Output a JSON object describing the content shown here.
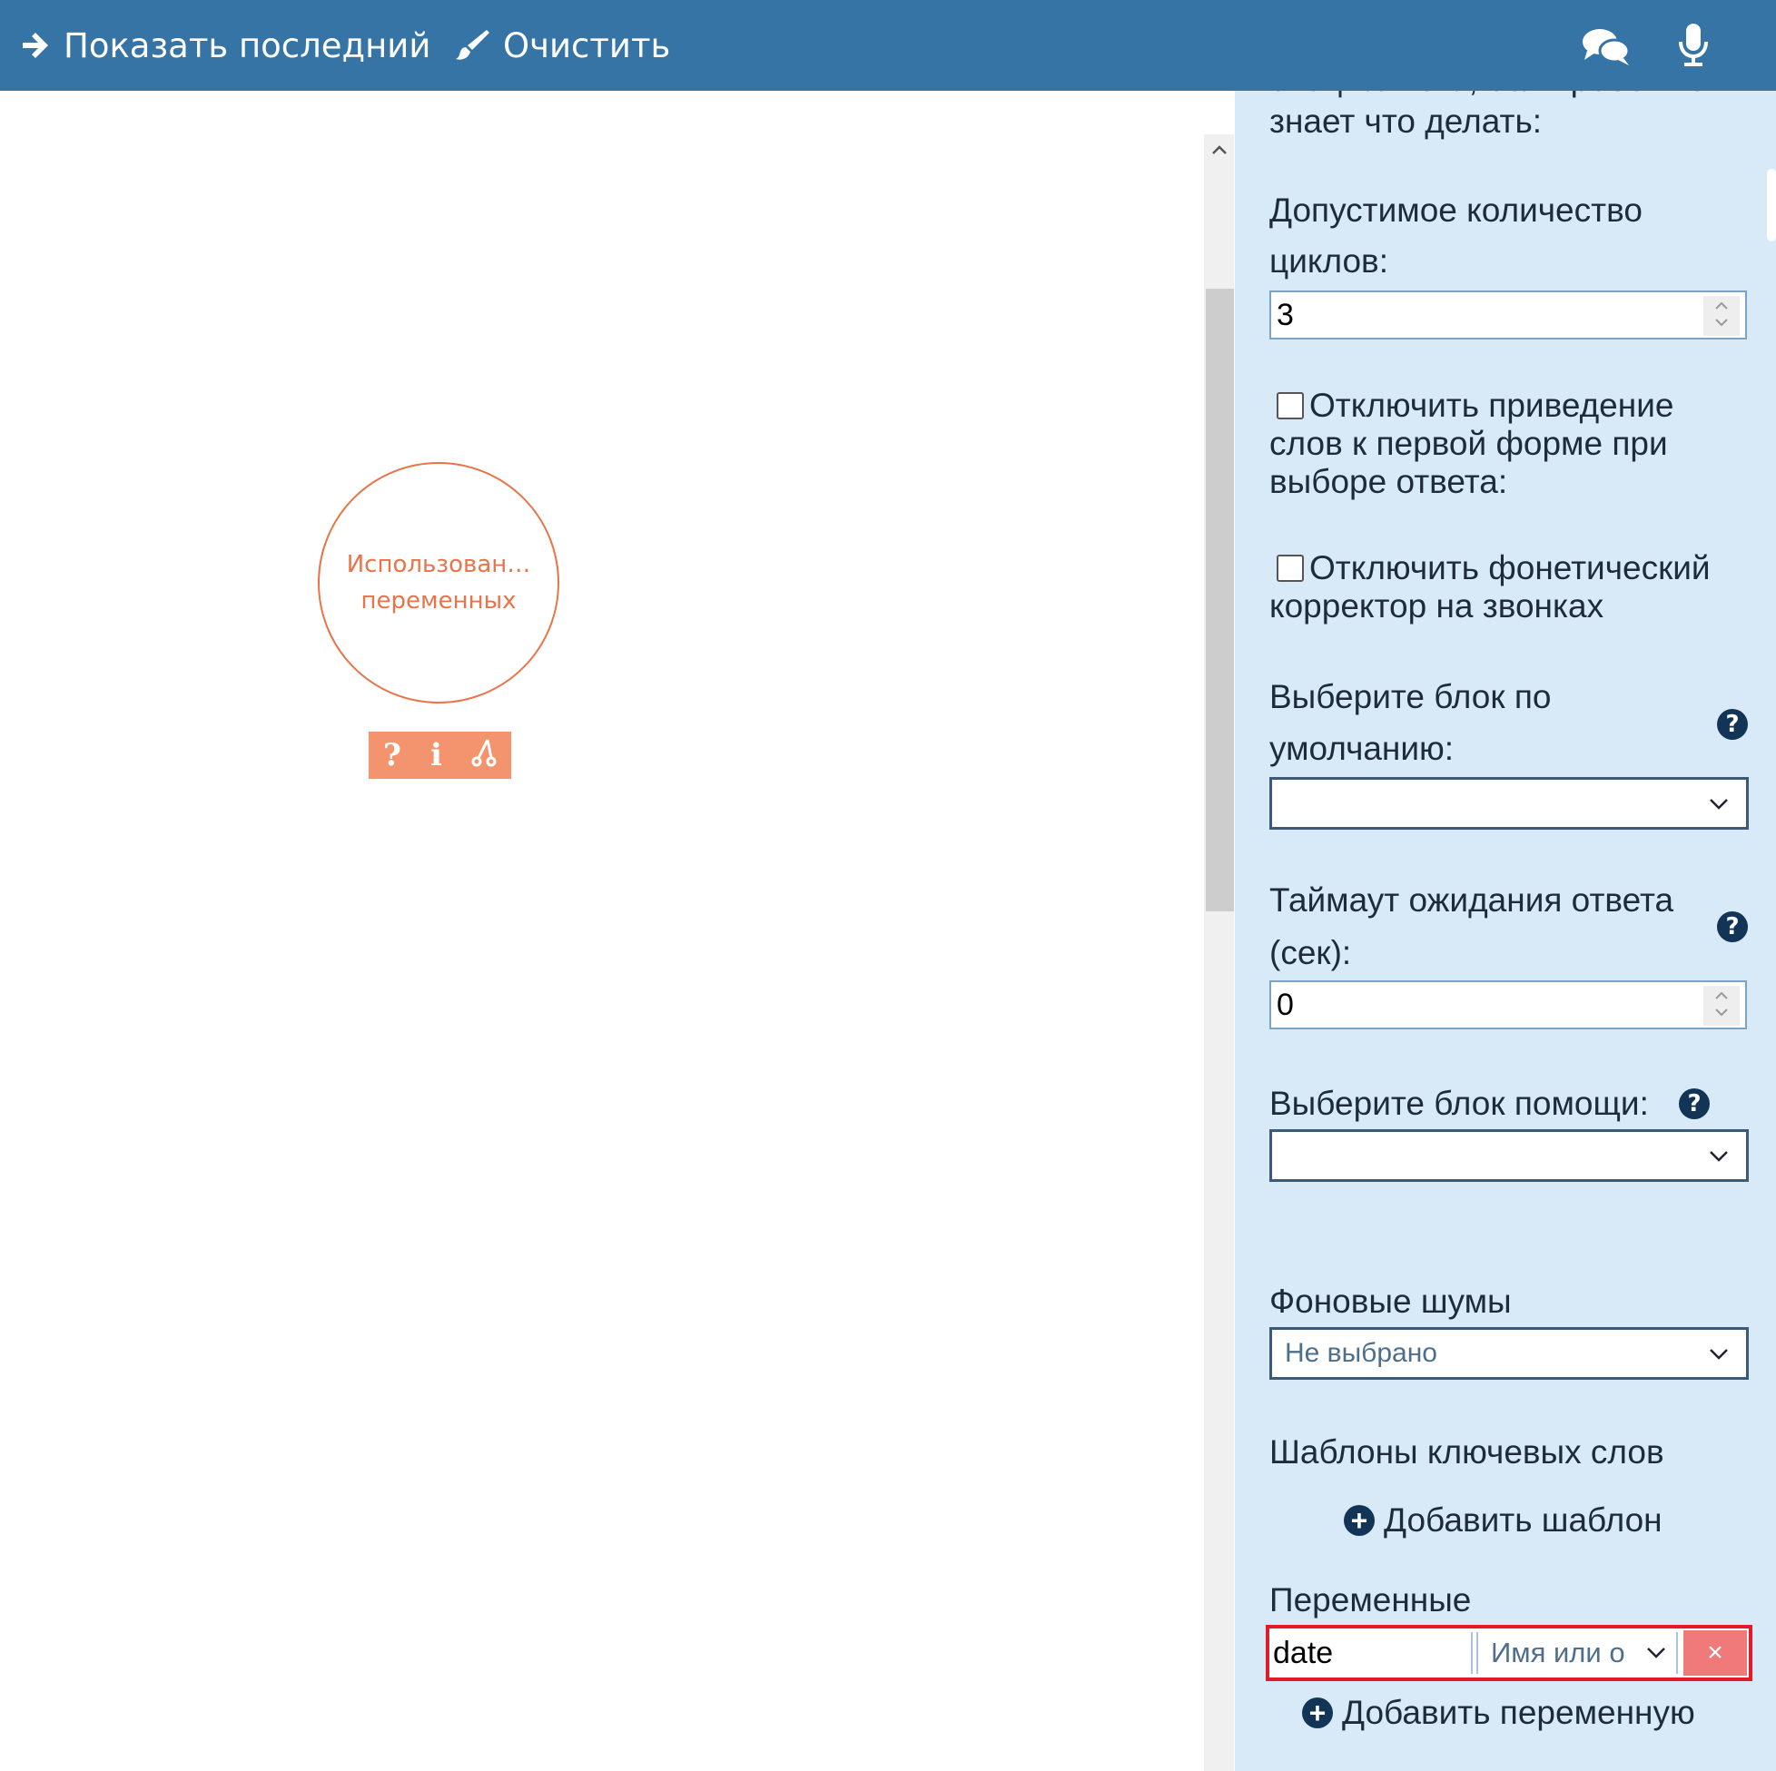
{
  "toolbar": {
    "show_last_label": "Показать последний",
    "clear_label": "Очистить",
    "chat_icon": "comments-icon",
    "mic_icon": "microphone-icon"
  },
  "canvas": {
    "node_label_line1": "Использован…",
    "node_label_line2": "переменных",
    "node_tools": [
      "?",
      "i",
      "⑂"
    ],
    "node_color": "#e8754a"
  },
  "panel": {
    "cut_text_top": "специалиста, если робот не",
    "cut_text_line2": "знает что делать:",
    "cycles_label_1": "Допустимое количество",
    "cycles_label_2": "циклов:",
    "cycles_value": "3",
    "disable_lemma_label_1": "Отключить приведение",
    "disable_lemma_label_2": "слов к первой форме при",
    "disable_lemma_label_3": "выборе ответа:",
    "disable_phonetic_label_1": "Отключить фонетический",
    "disable_phonetic_label_2": "корректор на звонках",
    "default_block_label_1": "Выберите блок по",
    "default_block_label_2": "умолчанию:",
    "default_block_value": "",
    "timeout_label_1": "Таймаут ожидания ответа",
    "timeout_label_2": "(сек):",
    "timeout_value": "0",
    "help_block_label": "Выберите блок помощи:",
    "help_block_value": "",
    "noise_label": "Фоновые шумы",
    "noise_value": "Не выбрано",
    "keyword_templates_label": "Шаблоны ключевых слов",
    "add_template_label": "Добавить шаблон",
    "variables_label": "Переменные",
    "variable_name_value": "date",
    "variable_select_placeholder": "Имя или о",
    "variable_delete": "×",
    "add_variable_label": "Добавить переменную",
    "help_glyph": "?",
    "highlight_color": "#e21a2a"
  }
}
